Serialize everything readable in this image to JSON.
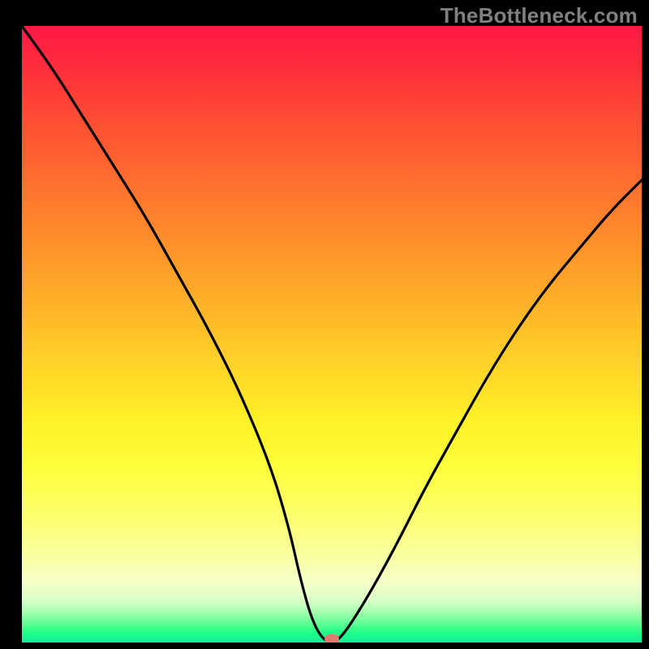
{
  "watermark": "TheBottleneck.com",
  "chart_data": {
    "type": "line",
    "title": "",
    "xlabel": "",
    "ylabel": "",
    "x_range": [
      0,
      100
    ],
    "y_range": [
      0,
      100
    ],
    "series": [
      {
        "name": "curve",
        "x": [
          0,
          5,
          10,
          15,
          20,
          25,
          30,
          35,
          40,
          43,
          45,
          47,
          49,
          51,
          55,
          60,
          65,
          70,
          75,
          80,
          85,
          90,
          95,
          100
        ],
        "y_pct": [
          100,
          93,
          85,
          77,
          69,
          60,
          51,
          41,
          29,
          19,
          10,
          3,
          0,
          0,
          6,
          15,
          25,
          34,
          43,
          51,
          58,
          64,
          70,
          75
        ]
      }
    ],
    "marker": {
      "x": 50,
      "y_pct": 0.5
    },
    "gradient": {
      "stops": [
        {
          "pos": 0.0,
          "color": "#ff1846"
        },
        {
          "pos": 0.5,
          "color": "#ffd028"
        },
        {
          "pos": 0.8,
          "color": "#fcff70"
        },
        {
          "pos": 0.95,
          "color": "#a8ffb0"
        },
        {
          "pos": 1.0,
          "color": "#13ec9b"
        }
      ]
    }
  }
}
